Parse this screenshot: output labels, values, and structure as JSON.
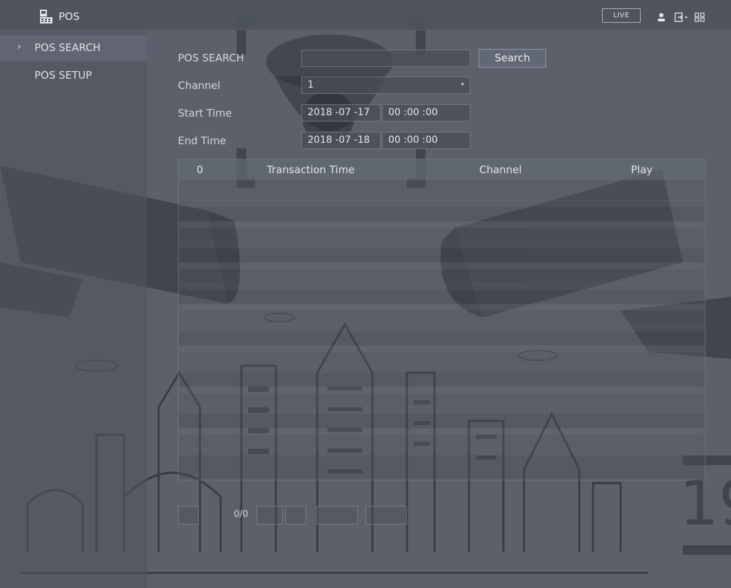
{
  "app": {
    "title": "POS",
    "live_label": "LIVE"
  },
  "header_icons": [
    "user-icon",
    "logout-icon",
    "grid-menu-icon"
  ],
  "sidebar": {
    "items": [
      {
        "label": "POS SEARCH",
        "active": true
      },
      {
        "label": "POS SETUP",
        "active": false
      }
    ]
  },
  "form": {
    "search_label": "POS SEARCH",
    "search_value": "",
    "search_button": "Search",
    "channel_label": "Channel",
    "channel_value": "1",
    "start_label": "Start Time",
    "start_date": "2018 -07 -17",
    "start_time": "00 :00 :00",
    "end_label": "End Time",
    "end_date": "2018 -07 -18",
    "end_time": "00 :00 :00"
  },
  "table": {
    "columns": [
      "0",
      "Transaction Time",
      "Channel",
      "Play"
    ],
    "rows": []
  },
  "pager": {
    "text": "0/0"
  },
  "colors": {
    "panel": "#4e535d",
    "text": "#d4d8de",
    "border": "#a0a6b0"
  }
}
